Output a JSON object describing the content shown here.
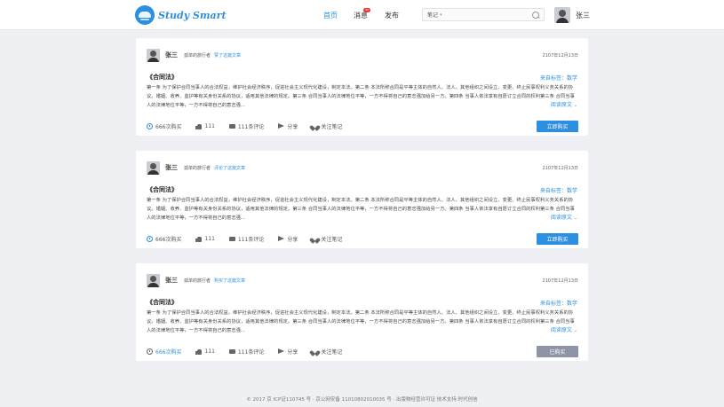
{
  "header": {
    "logo_text": "Study Smart",
    "nav": [
      {
        "label": "首页"
      },
      {
        "label": "消息",
        "badge": "99"
      },
      {
        "label": "发布"
      }
    ],
    "search": {
      "category": "笔记",
      "placeholder": ""
    },
    "user": {
      "name": "张三"
    }
  },
  "cards": [
    {
      "author": "张三",
      "author_tag": "孤单的旅行者",
      "action": "赞了这篇文章",
      "date": "2107年12月13日",
      "title": "《合同法》",
      "source": "来自标签：数学",
      "body": "第一条 为了保护合同当事人的合法权益，维护社会经济秩序，促进社会主义现代化建设，制定本法。第二条 本法所称合同是平等主体的自然人、法人、其他组织之间设立、变更、终止民事权利义务关系的协议。婚姻、收养、监护等有关身份关系的协议，适用其他法律的规定。第三条 合同当事人的法律地位平等，一方不得将自己的意志强加给另一方。第四条 当事人依法享有自愿订立合同的权利第三条 合同当事人的法律地位平等，一方不得将自己的意志强...",
      "read_more": "阅读原文",
      "stats": {
        "buys": "666次购买",
        "likes": "111",
        "comments": "111条评论",
        "share": "分享",
        "follow": "关注笔记"
      },
      "button": "立即购买",
      "bought": false
    },
    {
      "author": "张三",
      "author_tag": "孤单的旅行者",
      "action": "评论了这篇文章",
      "date": "2107年12月13日",
      "title": "《合同法》",
      "source": "来自标签：数学",
      "body": "第一条 为了保护合同当事人的合法权益，维护社会经济秩序，促进社会主义现代化建设，制定本法。第二条 本法所称合同是平等主体的自然人、法人、其他组织之间设立、变更、终止民事权利义务关系的协议。婚姻、收养、监护等有关身份关系的协议，适用其他法律的规定。第三条 合同当事人的法律地位平等，一方不得将自己的意志强加给另一方。第四条 当事人依法享有自愿订立合同的权利第三条 合同当事人的法律地位平等，一方不得将自己的意志强...",
      "read_more": "阅读原文",
      "stats": {
        "buys": "666次购买",
        "likes": "111",
        "comments": "111条评论",
        "share": "分享",
        "follow": "关注笔记"
      },
      "button": "立即购买",
      "bought": false
    },
    {
      "author": "张三",
      "author_tag": "孤单的旅行者",
      "action": "购买了这篇文章",
      "date": "2107年12月13日",
      "title": "《合同法》",
      "source": "来自标签：数学",
      "body": "第一条 为了保护合同当事人的合法权益，维护社会经济秩序，促进社会主义现代化建设，制定本法。第二条 本法所称合同是平等主体的自然人、法人、其他组织之间设立、变更、终止民事权利义务关系的协议。婚姻、收养、监护等有关身份关系的协议，适用其他法律的规定。第三条 合同当事人的法律地位平等，一方不得将自己的意志强加给另一方。第四条 当事人依法享有自愿订立合同的权利第三条 合同当事人的法律地位平等，一方不得将自己的意志强...",
      "read_more": "阅读原文",
      "stats": {
        "buys": "666次购买",
        "likes": "111",
        "comments": "111条评论",
        "share": "分享",
        "follow": "关注笔记"
      },
      "button": "已购买",
      "bought": true
    }
  ],
  "footer": {
    "text": "© 2017 京 ICP证110745 号 · 京公网安备 11010802010035 号 · 出版物经营许可证  技术支持:时代创信"
  }
}
